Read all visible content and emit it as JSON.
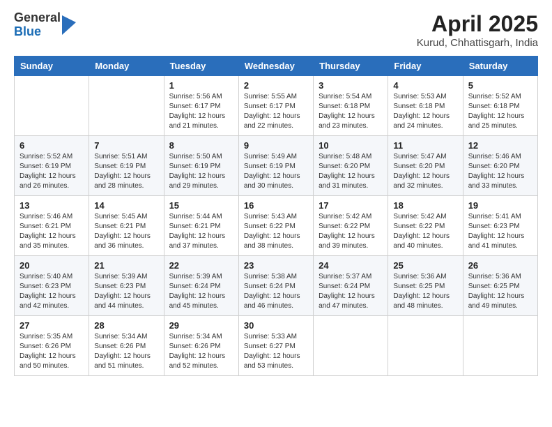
{
  "header": {
    "logo": {
      "general": "General",
      "blue": "Blue"
    },
    "title": "April 2025",
    "subtitle": "Kurud, Chhattisgarh, India"
  },
  "weekdays": [
    "Sunday",
    "Monday",
    "Tuesday",
    "Wednesday",
    "Thursday",
    "Friday",
    "Saturday"
  ],
  "weeks": [
    [
      {
        "day": "",
        "sunrise": "",
        "sunset": "",
        "daylight": ""
      },
      {
        "day": "",
        "sunrise": "",
        "sunset": "",
        "daylight": ""
      },
      {
        "day": "1",
        "sunrise": "Sunrise: 5:56 AM",
        "sunset": "Sunset: 6:17 PM",
        "daylight": "Daylight: 12 hours and 21 minutes."
      },
      {
        "day": "2",
        "sunrise": "Sunrise: 5:55 AM",
        "sunset": "Sunset: 6:17 PM",
        "daylight": "Daylight: 12 hours and 22 minutes."
      },
      {
        "day": "3",
        "sunrise": "Sunrise: 5:54 AM",
        "sunset": "Sunset: 6:18 PM",
        "daylight": "Daylight: 12 hours and 23 minutes."
      },
      {
        "day": "4",
        "sunrise": "Sunrise: 5:53 AM",
        "sunset": "Sunset: 6:18 PM",
        "daylight": "Daylight: 12 hours and 24 minutes."
      },
      {
        "day": "5",
        "sunrise": "Sunrise: 5:52 AM",
        "sunset": "Sunset: 6:18 PM",
        "daylight": "Daylight: 12 hours and 25 minutes."
      }
    ],
    [
      {
        "day": "6",
        "sunrise": "Sunrise: 5:52 AM",
        "sunset": "Sunset: 6:19 PM",
        "daylight": "Daylight: 12 hours and 26 minutes."
      },
      {
        "day": "7",
        "sunrise": "Sunrise: 5:51 AM",
        "sunset": "Sunset: 6:19 PM",
        "daylight": "Daylight: 12 hours and 28 minutes."
      },
      {
        "day": "8",
        "sunrise": "Sunrise: 5:50 AM",
        "sunset": "Sunset: 6:19 PM",
        "daylight": "Daylight: 12 hours and 29 minutes."
      },
      {
        "day": "9",
        "sunrise": "Sunrise: 5:49 AM",
        "sunset": "Sunset: 6:19 PM",
        "daylight": "Daylight: 12 hours and 30 minutes."
      },
      {
        "day": "10",
        "sunrise": "Sunrise: 5:48 AM",
        "sunset": "Sunset: 6:20 PM",
        "daylight": "Daylight: 12 hours and 31 minutes."
      },
      {
        "day": "11",
        "sunrise": "Sunrise: 5:47 AM",
        "sunset": "Sunset: 6:20 PM",
        "daylight": "Daylight: 12 hours and 32 minutes."
      },
      {
        "day": "12",
        "sunrise": "Sunrise: 5:46 AM",
        "sunset": "Sunset: 6:20 PM",
        "daylight": "Daylight: 12 hours and 33 minutes."
      }
    ],
    [
      {
        "day": "13",
        "sunrise": "Sunrise: 5:46 AM",
        "sunset": "Sunset: 6:21 PM",
        "daylight": "Daylight: 12 hours and 35 minutes."
      },
      {
        "day": "14",
        "sunrise": "Sunrise: 5:45 AM",
        "sunset": "Sunset: 6:21 PM",
        "daylight": "Daylight: 12 hours and 36 minutes."
      },
      {
        "day": "15",
        "sunrise": "Sunrise: 5:44 AM",
        "sunset": "Sunset: 6:21 PM",
        "daylight": "Daylight: 12 hours and 37 minutes."
      },
      {
        "day": "16",
        "sunrise": "Sunrise: 5:43 AM",
        "sunset": "Sunset: 6:22 PM",
        "daylight": "Daylight: 12 hours and 38 minutes."
      },
      {
        "day": "17",
        "sunrise": "Sunrise: 5:42 AM",
        "sunset": "Sunset: 6:22 PM",
        "daylight": "Daylight: 12 hours and 39 minutes."
      },
      {
        "day": "18",
        "sunrise": "Sunrise: 5:42 AM",
        "sunset": "Sunset: 6:22 PM",
        "daylight": "Daylight: 12 hours and 40 minutes."
      },
      {
        "day": "19",
        "sunrise": "Sunrise: 5:41 AM",
        "sunset": "Sunset: 6:23 PM",
        "daylight": "Daylight: 12 hours and 41 minutes."
      }
    ],
    [
      {
        "day": "20",
        "sunrise": "Sunrise: 5:40 AM",
        "sunset": "Sunset: 6:23 PM",
        "daylight": "Daylight: 12 hours and 42 minutes."
      },
      {
        "day": "21",
        "sunrise": "Sunrise: 5:39 AM",
        "sunset": "Sunset: 6:23 PM",
        "daylight": "Daylight: 12 hours and 44 minutes."
      },
      {
        "day": "22",
        "sunrise": "Sunrise: 5:39 AM",
        "sunset": "Sunset: 6:24 PM",
        "daylight": "Daylight: 12 hours and 45 minutes."
      },
      {
        "day": "23",
        "sunrise": "Sunrise: 5:38 AM",
        "sunset": "Sunset: 6:24 PM",
        "daylight": "Daylight: 12 hours and 46 minutes."
      },
      {
        "day": "24",
        "sunrise": "Sunrise: 5:37 AM",
        "sunset": "Sunset: 6:24 PM",
        "daylight": "Daylight: 12 hours and 47 minutes."
      },
      {
        "day": "25",
        "sunrise": "Sunrise: 5:36 AM",
        "sunset": "Sunset: 6:25 PM",
        "daylight": "Daylight: 12 hours and 48 minutes."
      },
      {
        "day": "26",
        "sunrise": "Sunrise: 5:36 AM",
        "sunset": "Sunset: 6:25 PM",
        "daylight": "Daylight: 12 hours and 49 minutes."
      }
    ],
    [
      {
        "day": "27",
        "sunrise": "Sunrise: 5:35 AM",
        "sunset": "Sunset: 6:26 PM",
        "daylight": "Daylight: 12 hours and 50 minutes."
      },
      {
        "day": "28",
        "sunrise": "Sunrise: 5:34 AM",
        "sunset": "Sunset: 6:26 PM",
        "daylight": "Daylight: 12 hours and 51 minutes."
      },
      {
        "day": "29",
        "sunrise": "Sunrise: 5:34 AM",
        "sunset": "Sunset: 6:26 PM",
        "daylight": "Daylight: 12 hours and 52 minutes."
      },
      {
        "day": "30",
        "sunrise": "Sunrise: 5:33 AM",
        "sunset": "Sunset: 6:27 PM",
        "daylight": "Daylight: 12 hours and 53 minutes."
      },
      {
        "day": "",
        "sunrise": "",
        "sunset": "",
        "daylight": ""
      },
      {
        "day": "",
        "sunrise": "",
        "sunset": "",
        "daylight": ""
      },
      {
        "day": "",
        "sunrise": "",
        "sunset": "",
        "daylight": ""
      }
    ]
  ]
}
